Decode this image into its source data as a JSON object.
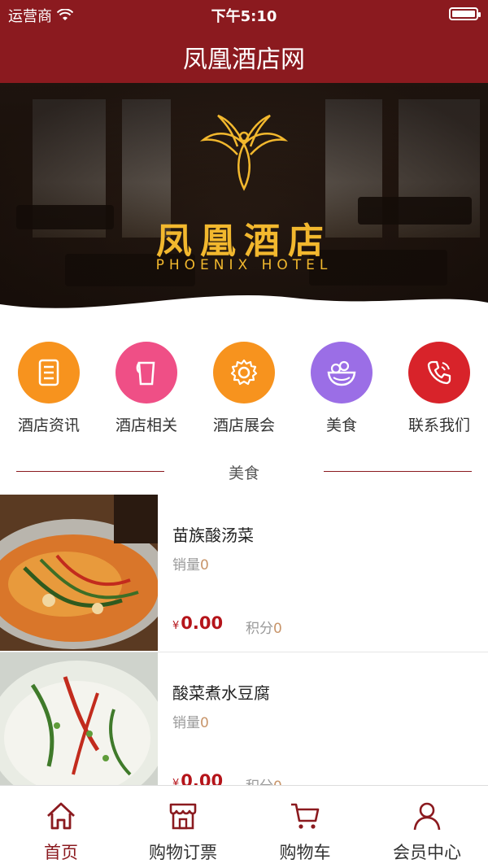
{
  "status_bar": {
    "carrier": "运营商",
    "time": "下午5:10"
  },
  "nav": {
    "title": "凤凰酒店网"
  },
  "banner": {
    "brand_cn": "凤凰酒店",
    "brand_en": "PHOENIX HOTEL"
  },
  "categories": [
    {
      "label": "酒店资讯",
      "icon": "document-list-icon",
      "color": "#f7931e"
    },
    {
      "label": "酒店相关",
      "icon": "cup-icon",
      "color": "#ef4f86"
    },
    {
      "label": "酒店展会",
      "icon": "gear-icon",
      "color": "#f7931e"
    },
    {
      "label": "美食",
      "icon": "salad-bowl-icon",
      "color": "#9b6ee6"
    },
    {
      "label": "联系我们",
      "icon": "phone-icon",
      "color": "#d8232a"
    }
  ],
  "section": {
    "title": "美食"
  },
  "products": [
    {
      "name": "苗族酸汤菜",
      "sales_label": "销量",
      "sales": "0",
      "currency": "¥",
      "price": "0.00",
      "points_label": "积分",
      "points": "0"
    },
    {
      "name": "酸菜煮水豆腐",
      "sales_label": "销量",
      "sales": "0",
      "currency": "¥",
      "price": "0.00",
      "points_label": "积分",
      "points": "0"
    }
  ],
  "tabbar": [
    {
      "label": "首页",
      "icon": "home-icon",
      "active": true
    },
    {
      "label": "购物订票",
      "icon": "shop-icon",
      "active": false
    },
    {
      "label": "购物车",
      "icon": "cart-icon",
      "active": false
    },
    {
      "label": "会员中心",
      "icon": "user-icon",
      "active": false
    }
  ],
  "colors": {
    "brand": "#8b1a1f",
    "gold": "#f2b82e",
    "price": "#b5141a"
  }
}
